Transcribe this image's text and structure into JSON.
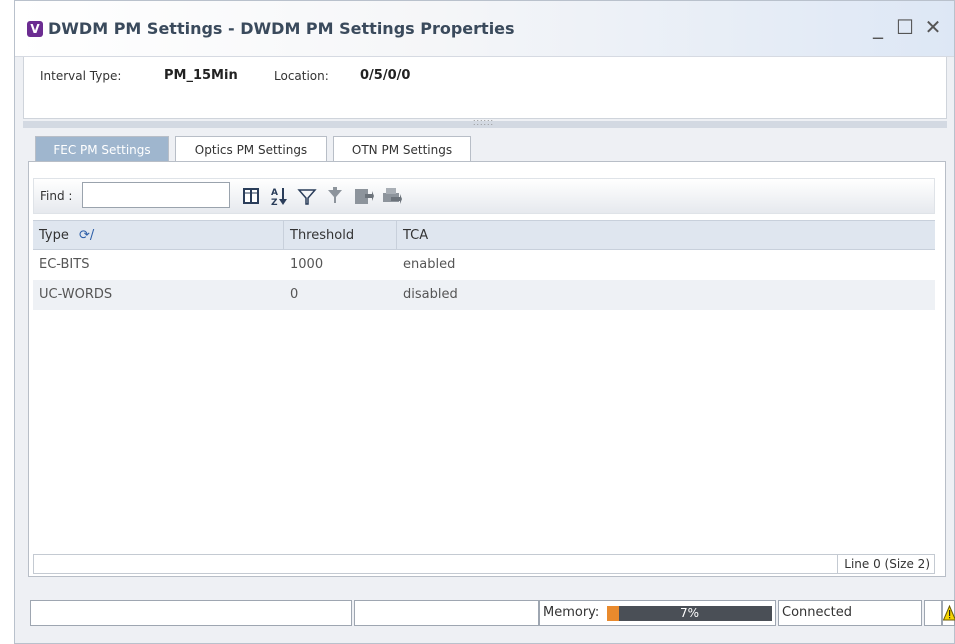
{
  "window": {
    "app_icon_letter": "V",
    "title": "DWDM PM Settings - DWDM PM Settings Properties",
    "minimize_glyph": "_",
    "maximize_glyph": "☐",
    "close_glyph": "✕"
  },
  "info": {
    "interval_label": "Interval Type:",
    "interval_value": "PM_15Min",
    "location_label": "Location:",
    "location_value": "0/5/0/0"
  },
  "tabs": [
    {
      "label": "FEC PM Settings",
      "active": true
    },
    {
      "label": "Optics PM Settings",
      "active": false
    },
    {
      "label": "OTN PM Settings",
      "active": false
    }
  ],
  "toolbar": {
    "find_label": "Find :",
    "find_value": "",
    "icons": [
      "column-chooser-icon",
      "sort-az-icon",
      "filter-icon",
      "advanced-filter-icon",
      "export-icon",
      "print-icon"
    ]
  },
  "table": {
    "columns": [
      "Type",
      "Threshold",
      "TCA"
    ],
    "sort_indicator": "⟳/",
    "rows": [
      {
        "type": "EC-BITS",
        "threshold": "1000",
        "tca": "enabled"
      },
      {
        "type": "UC-WORDS",
        "threshold": "0",
        "tca": "disabled"
      }
    ],
    "footer": "Line 0 (Size 2)"
  },
  "statusbar": {
    "memory_label": "Memory:",
    "memory_percent_text": "7%",
    "memory_fraction": 0.07,
    "connection": "Connected",
    "warning_icon": "warning-icon"
  },
  "colors": {
    "active_tab": "#9fb6ce",
    "memory_fill": "#e98a2d",
    "memory_bar": "#4a4f56",
    "app_icon": "#6b2c91"
  }
}
